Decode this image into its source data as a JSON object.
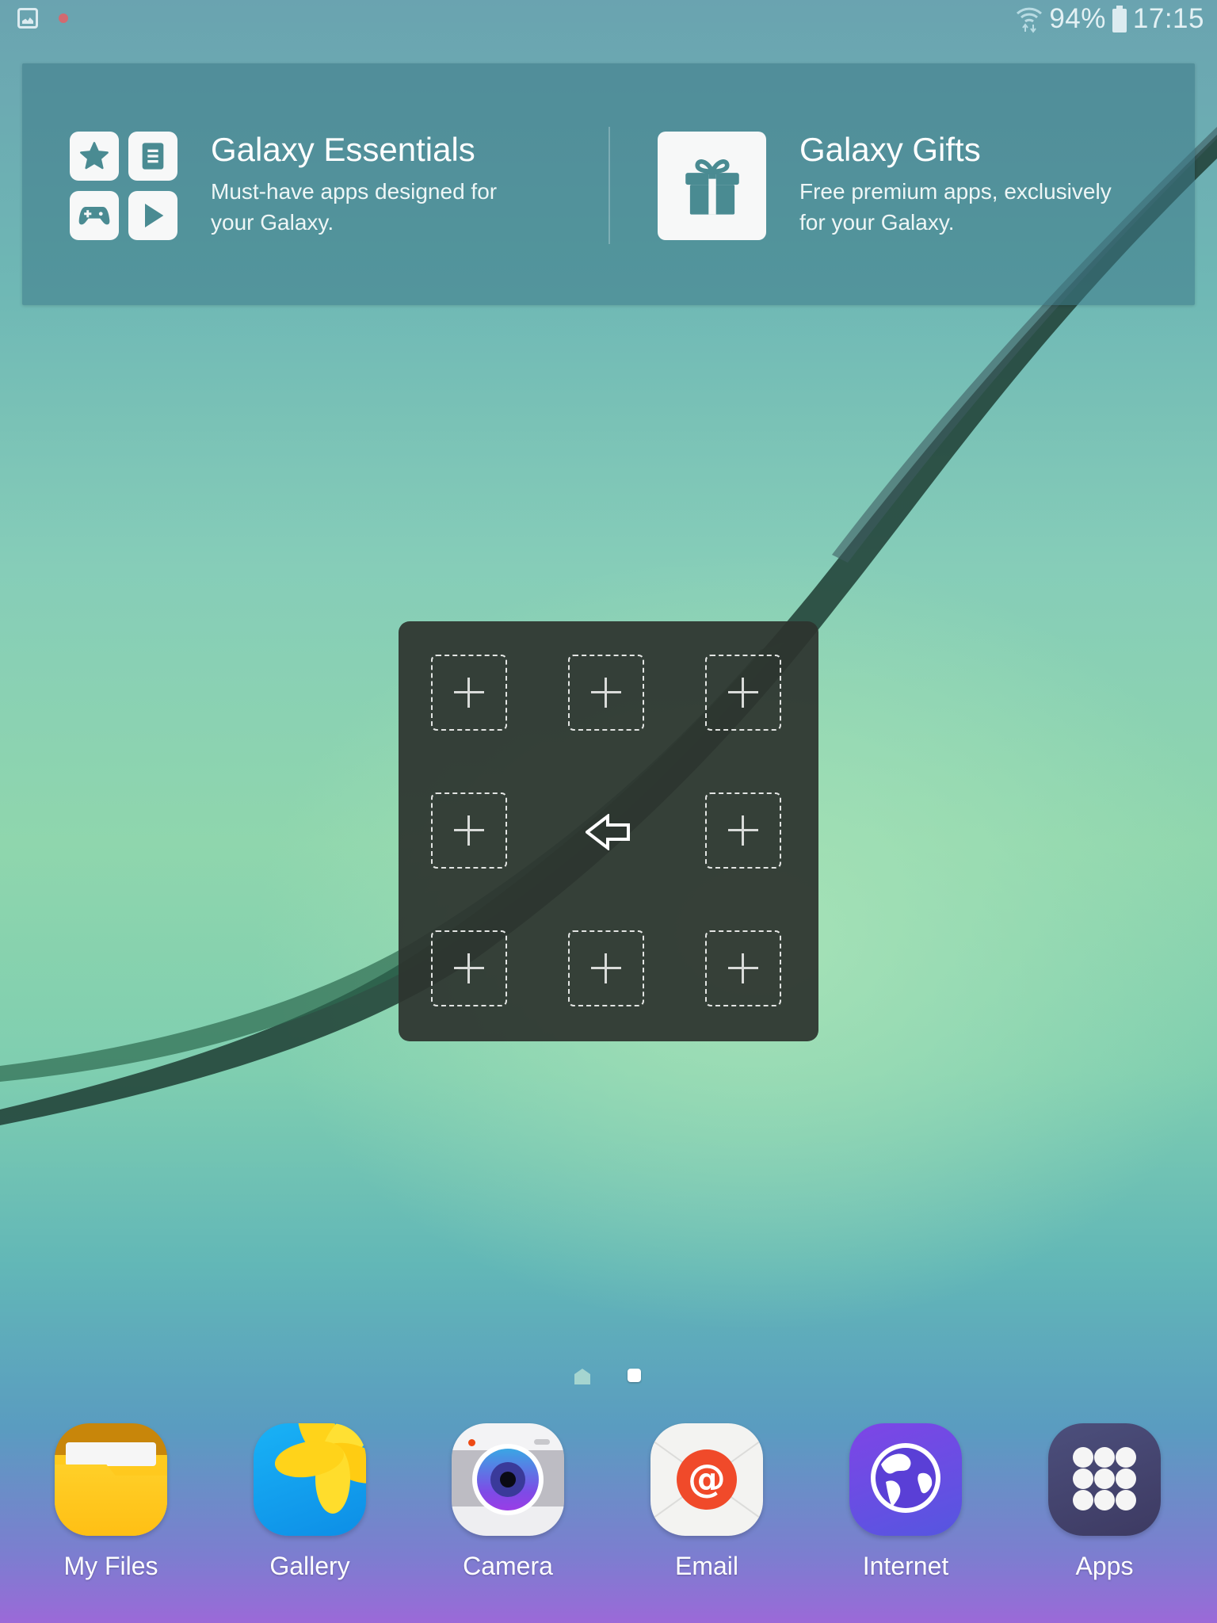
{
  "status_bar": {
    "left_icons": [
      "image-notification-icon",
      "recording-dot-icon"
    ],
    "wifi_icon": "wifi-data-icon",
    "battery_percent": "94%",
    "battery_icon": "battery-icon",
    "time": "17:15"
  },
  "galaxy_widget": {
    "essentials": {
      "title": "Galaxy Essentials",
      "description": "Must-have apps designed for your Galaxy.",
      "icons": [
        "star-icon",
        "document-icon",
        "gamepad-icon",
        "play-icon"
      ]
    },
    "gifts": {
      "title": "Galaxy Gifts",
      "description": "Free premium apps, exclusively for your Galaxy.",
      "icon": "gift-icon"
    }
  },
  "add_panel": {
    "slots": [
      "add",
      "add",
      "add",
      "add",
      "back",
      "add",
      "add",
      "add",
      "add"
    ],
    "center_icon": "back-arrow-icon"
  },
  "page_indicator": {
    "pages": [
      "home",
      "page"
    ],
    "current": 2
  },
  "dock": {
    "apps": [
      {
        "label": "My Files",
        "icon": "folder-icon",
        "color": "#ffc21a"
      },
      {
        "label": "Gallery",
        "icon": "flower-icon",
        "color": "#19b2f6"
      },
      {
        "label": "Camera",
        "icon": "camera-icon",
        "color": "#bdbcc3"
      },
      {
        "label": "Email",
        "icon": "email-at-icon",
        "color": "#f04a2a"
      },
      {
        "label": "Internet",
        "icon": "globe-icon",
        "color": "#6a4ee4"
      },
      {
        "label": "Apps",
        "icon": "app-grid-icon",
        "color": "#45466f"
      }
    ]
  }
}
